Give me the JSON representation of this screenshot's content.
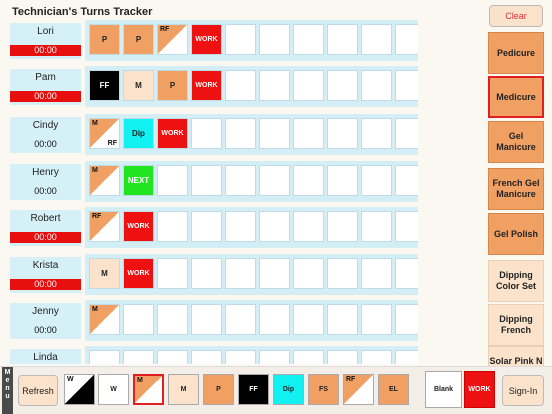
{
  "title": "Technician's Turns Tracker",
  "clear_label": "Clear",
  "technicians": [
    {
      "name": "Lori",
      "timer": "00:00",
      "timer_red": true,
      "cells": [
        {
          "type": "P",
          "label": "P"
        },
        {
          "type": "P",
          "label": "P"
        },
        {
          "type": "diag",
          "top": "RF",
          "bottom": ""
        },
        {
          "type": "WORK",
          "label": "WORK"
        },
        {
          "type": "empty"
        },
        {
          "type": "empty"
        },
        {
          "type": "empty"
        },
        {
          "type": "empty"
        },
        {
          "type": "empty"
        },
        {
          "type": "empty"
        }
      ]
    },
    {
      "name": "Pam",
      "timer": "00:00",
      "timer_red": true,
      "cells": [
        {
          "type": "FF",
          "label": "FF"
        },
        {
          "type": "M",
          "label": "M"
        },
        {
          "type": "P",
          "label": "P"
        },
        {
          "type": "WORK",
          "label": "WORK"
        },
        {
          "type": "empty"
        },
        {
          "type": "empty"
        },
        {
          "type": "empty"
        },
        {
          "type": "empty"
        },
        {
          "type": "empty"
        },
        {
          "type": "empty"
        }
      ]
    },
    {
      "name": "Cindy",
      "timer": "00:00",
      "timer_red": false,
      "cells": [
        {
          "type": "diag",
          "top": "M",
          "bottom": "RF"
        },
        {
          "type": "Dip",
          "label": "Dip"
        },
        {
          "type": "WORK",
          "label": "WORK"
        },
        {
          "type": "empty"
        },
        {
          "type": "empty"
        },
        {
          "type": "empty"
        },
        {
          "type": "empty"
        },
        {
          "type": "empty"
        },
        {
          "type": "empty"
        },
        {
          "type": "empty"
        }
      ]
    },
    {
      "name": "Henry",
      "timer": "00:00",
      "timer_red": false,
      "cells": [
        {
          "type": "diag",
          "top": "M",
          "bottom": ""
        },
        {
          "type": "NEXT",
          "label": "NEXT"
        },
        {
          "type": "empty"
        },
        {
          "type": "empty"
        },
        {
          "type": "empty"
        },
        {
          "type": "empty"
        },
        {
          "type": "empty"
        },
        {
          "type": "empty"
        },
        {
          "type": "empty"
        },
        {
          "type": "empty"
        }
      ]
    },
    {
      "name": "Robert",
      "timer": "00:00",
      "timer_red": true,
      "cells": [
        {
          "type": "diag",
          "top": "RF",
          "bottom": ""
        },
        {
          "type": "WORK",
          "label": "WORK"
        },
        {
          "type": "empty"
        },
        {
          "type": "empty"
        },
        {
          "type": "empty"
        },
        {
          "type": "empty"
        },
        {
          "type": "empty"
        },
        {
          "type": "empty"
        },
        {
          "type": "empty"
        },
        {
          "type": "empty"
        }
      ]
    },
    {
      "name": "Krista",
      "timer": "00:00",
      "timer_red": true,
      "cells": [
        {
          "type": "M",
          "label": "M"
        },
        {
          "type": "WORK",
          "label": "WORK"
        },
        {
          "type": "empty"
        },
        {
          "type": "empty"
        },
        {
          "type": "empty"
        },
        {
          "type": "empty"
        },
        {
          "type": "empty"
        },
        {
          "type": "empty"
        },
        {
          "type": "empty"
        },
        {
          "type": "empty"
        }
      ]
    },
    {
      "name": "Jenny",
      "timer": "00:00",
      "timer_red": false,
      "cells": [
        {
          "type": "diag",
          "top": "M",
          "bottom": ""
        },
        {
          "type": "empty"
        },
        {
          "type": "empty"
        },
        {
          "type": "empty"
        },
        {
          "type": "empty"
        },
        {
          "type": "empty"
        },
        {
          "type": "empty"
        },
        {
          "type": "empty"
        },
        {
          "type": "empty"
        },
        {
          "type": "empty"
        }
      ]
    },
    {
      "name": "Linda",
      "timer": "",
      "timer_red": false,
      "cells": [
        {
          "type": "empty"
        },
        {
          "type": "empty"
        },
        {
          "type": "empty"
        },
        {
          "type": "empty"
        },
        {
          "type": "empty"
        },
        {
          "type": "empty"
        },
        {
          "type": "empty"
        },
        {
          "type": "empty"
        },
        {
          "type": "empty"
        },
        {
          "type": "empty"
        }
      ]
    }
  ],
  "services": [
    {
      "label": "Pedicure",
      "style": "dark",
      "selected": false
    },
    {
      "label": "Medicure",
      "style": "dark",
      "selected": true
    },
    {
      "label": "Gel Manicure",
      "style": "dark",
      "selected": false
    },
    {
      "label": "French Gel Manicure",
      "style": "dark",
      "selected": false
    },
    {
      "label": "Gel Polish",
      "style": "dark",
      "selected": false
    },
    {
      "label": "Dipping Color Set",
      "style": "light",
      "selected": false
    },
    {
      "label": "Dipping French",
      "style": "light",
      "selected": false
    },
    {
      "label": "Solar Pink N White set",
      "style": "light",
      "selected": false
    }
  ],
  "toolbar": {
    "menu_label": "Menu",
    "refresh_label": "Refresh",
    "swatches": [
      {
        "kind": "wdiag",
        "label": "W"
      },
      {
        "kind": "plain",
        "label": "W",
        "bg": "#ffffff",
        "fg": "#222222"
      },
      {
        "kind": "mdiag",
        "label": "M",
        "selected": true
      },
      {
        "kind": "plain",
        "label": "M",
        "bg": "#fbe3cb",
        "fg": "#222222"
      },
      {
        "kind": "plain",
        "label": "P",
        "bg": "#f0a063",
        "fg": "#222222"
      },
      {
        "kind": "plain",
        "label": "FF",
        "bg": "#000000",
        "fg": "#ffffff"
      },
      {
        "kind": "plain",
        "label": "Dip",
        "bg": "#11f1f1",
        "fg": "#222222"
      },
      {
        "kind": "plain",
        "label": "FS",
        "bg": "#f0a063",
        "fg": "#222222"
      },
      {
        "kind": "rfdiag",
        "label": "RF"
      },
      {
        "kind": "plain",
        "label": "EL",
        "bg": "#f0a063",
        "fg": "#222222"
      }
    ],
    "blank_label": "Blank",
    "work_label": "WORK",
    "signin_label": "Sign-In"
  }
}
